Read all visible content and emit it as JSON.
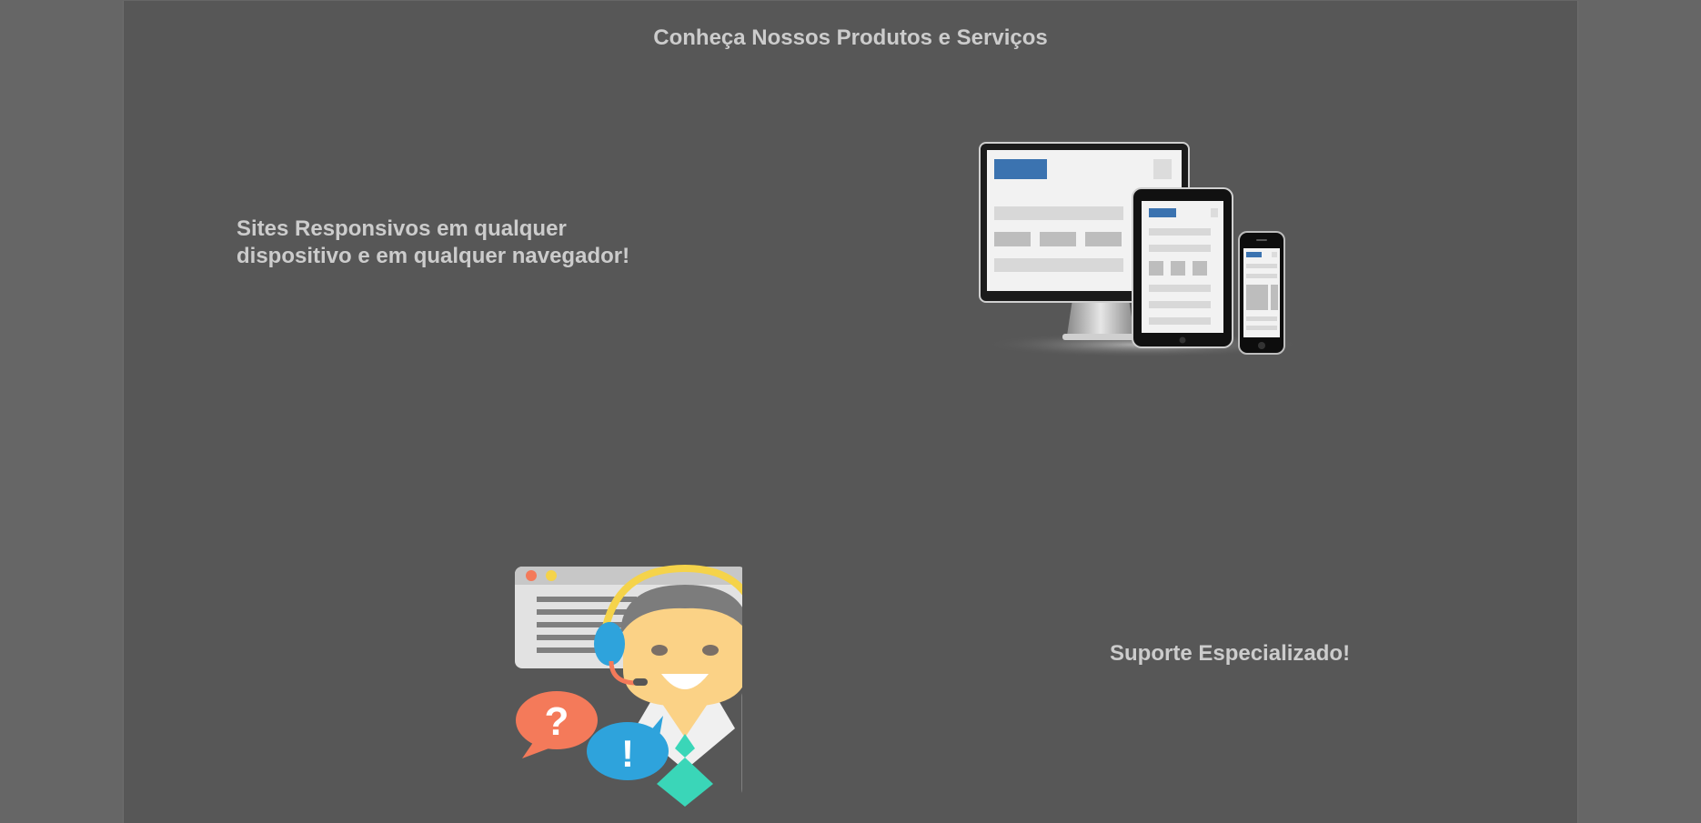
{
  "section": {
    "title": "Conheça Nossos Produtos e Serviços"
  },
  "features": [
    {
      "text_line1": "Sites Responsivos em qualquer",
      "text_line2": "dispositivo e em qualquer navegador!",
      "image_icon": "responsive-devices-icon"
    },
    {
      "text_line1": "Suporte Especializado!",
      "image_icon": "support-agent-icon"
    }
  ],
  "colors": {
    "page_background": "#666666",
    "content_background": "#575757",
    "text": "#cccccc",
    "accent_blue": "#3b73b0",
    "support_blue": "#2ea3dc",
    "support_orange": "#f47a5a",
    "support_teal": "#3ad6b8",
    "headset_yellow": "#f5d34a"
  }
}
